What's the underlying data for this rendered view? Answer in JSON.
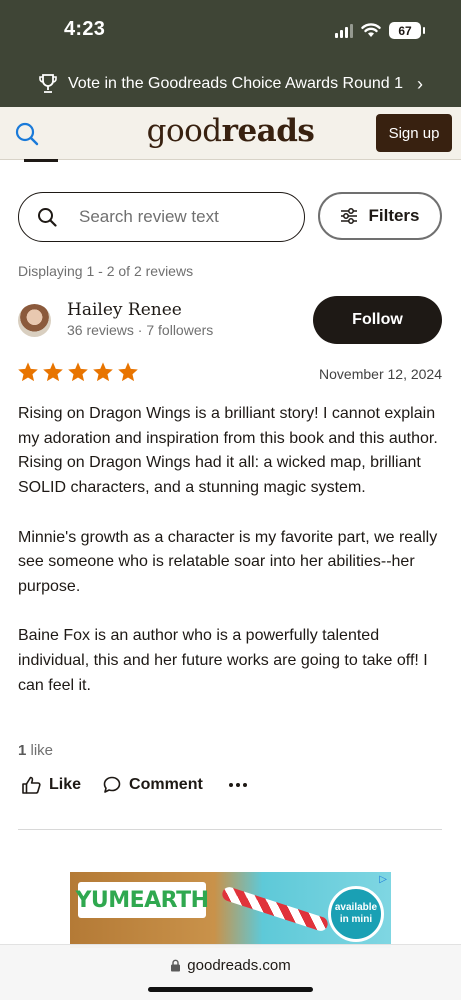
{
  "status_bar": {
    "time": "4:23",
    "battery": "67"
  },
  "banner": {
    "text": "Vote in the Goodreads Choice Awards Round 1"
  },
  "header": {
    "logo_light": "good",
    "logo_bold": "reads",
    "signup_label": "Sign up"
  },
  "search": {
    "placeholder": "Search review text",
    "filters_label": "Filters"
  },
  "display_count": "Displaying 1 - 2 of 2 reviews",
  "review": {
    "reviewer_name": "Hailey Renee",
    "reviewer_meta": "36 reviews · 7 followers",
    "follow_label": "Follow",
    "rating": 5,
    "max_rating": 5,
    "star_color": "#e87400",
    "date": "November 12, 2024",
    "paragraphs": [
      "Rising on Dragon Wings is a brilliant story! I cannot explain my adoration and inspiration from this book and this author. Rising on Dragon Wings had it all: a wicked map, brilliant SOLID characters, and a stunning magic system.",
      "Minnie's growth as a character is my favorite part, we really see someone who is relatable soar into her abilities--her purpose.",
      "Baine Fox is an author who is a powerfully talented individual, this and her future works are going to take off! I can feel it."
    ],
    "likes_count": "1",
    "likes_word": "like",
    "like_label": "Like",
    "comment_label": "Comment"
  },
  "ad": {
    "brand": "YUMEARTH",
    "badge": "available in mini"
  },
  "url_bar": {
    "domain": "goodreads.com"
  },
  "colors": {
    "top_bg": "#3f4536",
    "header_bg": "#f4f1ea",
    "brand_brown": "#382110",
    "dark": "#1e1915"
  }
}
